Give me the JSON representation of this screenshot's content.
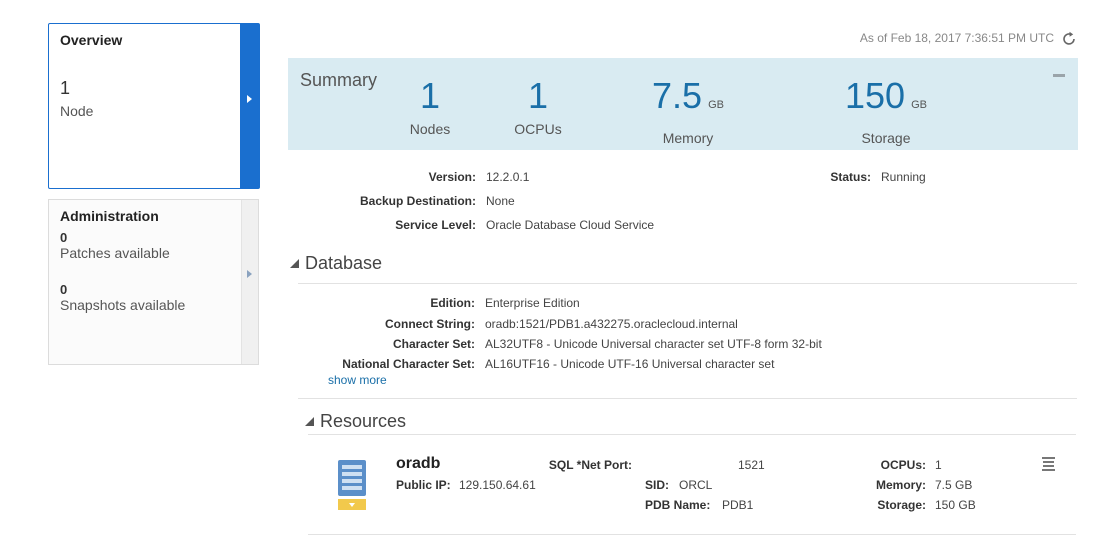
{
  "overview": {
    "title": "Overview",
    "count": "1",
    "label": "Node"
  },
  "administration": {
    "title": "Administration",
    "patches_count": "0",
    "patches_label": "Patches available",
    "snapshots_count": "0",
    "snapshots_label": "Snapshots available"
  },
  "header": {
    "as_of": "As of Feb 18, 2017 7:36:51 PM UTC",
    "refresh_icon": "refresh-icon"
  },
  "summary": {
    "title": "Summary",
    "metrics": [
      {
        "value": "1",
        "unit": "",
        "label": "Nodes"
      },
      {
        "value": "1",
        "unit": "",
        "label": "OCPUs"
      },
      {
        "value": "7.5",
        "unit": "GB",
        "label": "Memory"
      },
      {
        "value": "150",
        "unit": "GB",
        "label": "Storage"
      }
    ]
  },
  "service": {
    "version_label": "Version:",
    "version": "12.2.0.1",
    "backup_label": "Backup Destination:",
    "backup": "None",
    "level_label": "Service Level:",
    "level": "Oracle Database Cloud Service",
    "status_label": "Status:",
    "status": "Running"
  },
  "database": {
    "title": "Database",
    "edition_label": "Edition:",
    "edition": "Enterprise Edition",
    "connect_label": "Connect String:",
    "connect": "oradb:1521/PDB1.a432275.oraclecloud.internal",
    "charset_label": "Character Set:",
    "charset": "AL32UTF8 - Unicode Universal character set UTF-8 form 32-bit",
    "ncharset_label": "National Character Set:",
    "ncharset": "AL16UTF16 - Unicode UTF-16 Universal character set",
    "show_more": "show more"
  },
  "resources": {
    "title": "Resources",
    "item": {
      "name": "oradb",
      "ip_label": "Public IP:",
      "ip": "129.150.64.61",
      "port_label": "SQL *Net Port:",
      "port": "1521",
      "sid_label": "SID:",
      "sid": "ORCL",
      "pdb_label": "PDB Name:",
      "pdb": "PDB1",
      "ocpus_label": "OCPUs:",
      "ocpus": "1",
      "memory_label": "Memory:",
      "memory": "7.5 GB",
      "storage_label": "Storage:",
      "storage": "150 GB"
    }
  },
  "colors": {
    "accent": "#1a6fcf",
    "summary_bg": "#d9ebf2",
    "metric_text": "#1a6fa8"
  }
}
